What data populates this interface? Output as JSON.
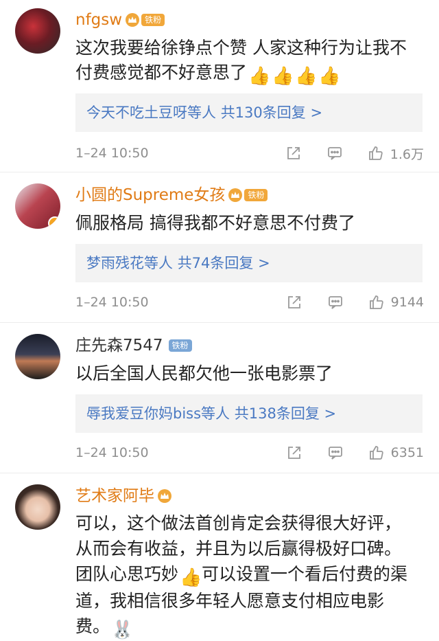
{
  "comments": [
    {
      "name": "nfgsw",
      "badge": "铁粉",
      "text": "这次我要给徐铮点个赞 人家这种行为让我不付费感觉都不好意思了",
      "thumbs": 4,
      "reply_user": "今天不吃土豆呀等人",
      "reply_count": "共130条回复 >",
      "time": "1–24 10:50",
      "likes": "1.6万"
    },
    {
      "name": "小圆的Supreme女孩",
      "badge": "铁粉",
      "text": "佩服格局 搞得我都不好意思不付费了",
      "reply_user": "梦雨残花等人",
      "reply_count": "共74条回复 >",
      "time": "1–24 10:50",
      "likes": "9144"
    },
    {
      "name": "庄先森7547",
      "badge": "铁粉",
      "text": "以后全国人民都欠他一张电影票了",
      "reply_user": "辱我爱豆你妈biss等人",
      "reply_count": "共138条回复 >",
      "time": "1–24 10:50",
      "likes": "6351"
    },
    {
      "name": "艺术家阿毕",
      "text_line1": "可以，这个做法首创肯定会获得很大好评，",
      "text_line2": "从而会有收益，并且为以后赢得极好口碑。",
      "text_line3a": "团队心思巧妙",
      "text_line3b": "可以设置一个看后付费的渠",
      "text_line4": "道，我相信很多年轻人愿意支付相应电影",
      "text_line5": "费。"
    }
  ],
  "colors": {
    "member_name": "#e07b15",
    "link": "#4a79c2",
    "meta": "#8e8e8e"
  },
  "icons": [
    "crown-icon",
    "share-icon",
    "comment-icon",
    "like-icon",
    "thumbs-up-emoji",
    "bunny-emoji"
  ]
}
